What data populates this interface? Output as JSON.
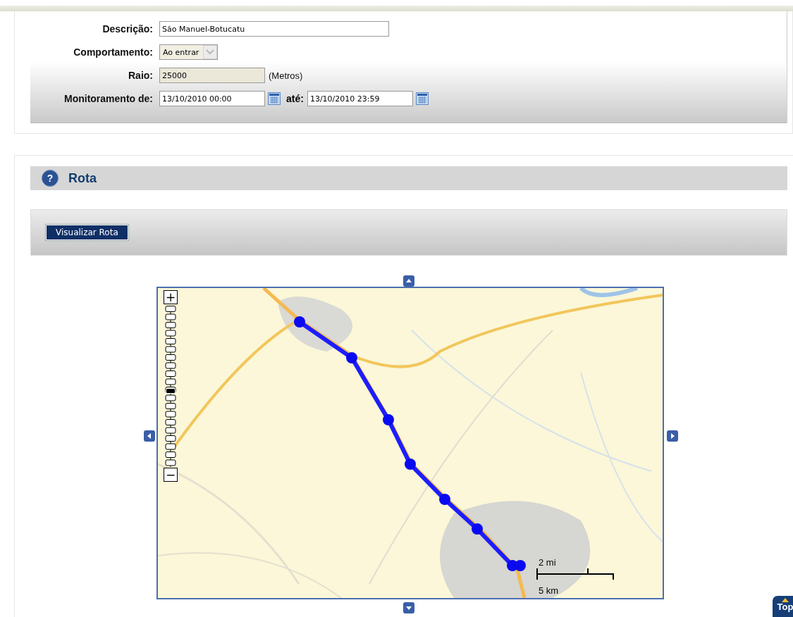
{
  "form": {
    "fields": [
      {
        "kind": "text",
        "label": "Descrição:",
        "value": "São Manuel-Botucatu"
      },
      {
        "kind": "select",
        "label": "Comportamento:",
        "value": "Ao entrar"
      },
      {
        "kind": "readonly",
        "label": "Raio:",
        "value": "25000",
        "unit": "(Metros)"
      },
      {
        "kind": "daterange",
        "label": "Monitoramento de:",
        "value": "13/10/2010 00:00",
        "to_label": "até:",
        "to_value": "13/10/2010 23:59"
      }
    ]
  },
  "section": {
    "help": "?",
    "title": "Rota",
    "button": "Visualizar Rota",
    "map": {
      "zoom_in": "+",
      "zoom_out": "−",
      "zoom": {
        "level": 0.47
      },
      "scale": {
        "top": "2 mi",
        "bottom": "5 km"
      }
    }
  },
  "top_button": "Top"
}
